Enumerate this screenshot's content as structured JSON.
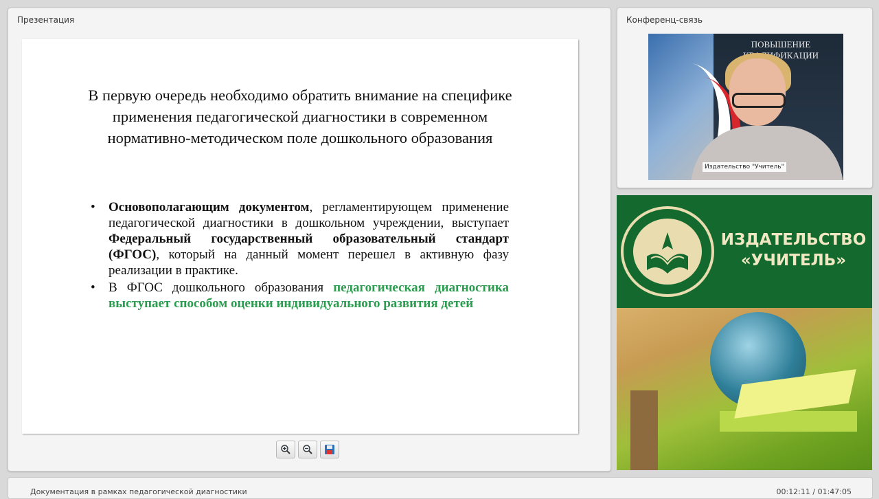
{
  "presentation": {
    "panel_title": "Презентация",
    "slide": {
      "title": "В первую очередь необходимо обратить  внимание на специфике применения педагогической диагностики в современном нормативно-методическом поле дошкольного образования",
      "bullet1": {
        "bold": "Основополагающим документом",
        "text1": ", регламентирующем применение педагогической диагностики в дошкольном учреждении, выступает ",
        "bold2": "Федеральный государственный образовательный стандарт (ФГОС)",
        "text2": ", который на данный момент перешел в активную фазу реализации в практике."
      },
      "bullet2": {
        "text": "В ФГОС дошкольного образования ",
        "green": "педагогическая диагностика выступает способом оценки индивидуального развития детей"
      }
    },
    "toolbar": {
      "zoom_in_icon": "zoom-in-icon",
      "zoom_out_icon": "zoom-out-icon",
      "save_icon": "floppy-disk-icon"
    }
  },
  "conference": {
    "panel_title": "Конференц-связь",
    "banner_text": "ПОВЫШЕНИЕ КВАЛИФИКАЦИИ",
    "video_caption": "Издательство \"Учитель\""
  },
  "brand": {
    "line1": "ИЗДАТЕЛЬСТВО",
    "line2": "«УЧИТЕЛЬ»",
    "color": "#146a2e"
  },
  "bottom": {
    "document_title": "Документация в рамках педагогической диагностики",
    "timecode": "00:12:11 / 01:47:05"
  }
}
